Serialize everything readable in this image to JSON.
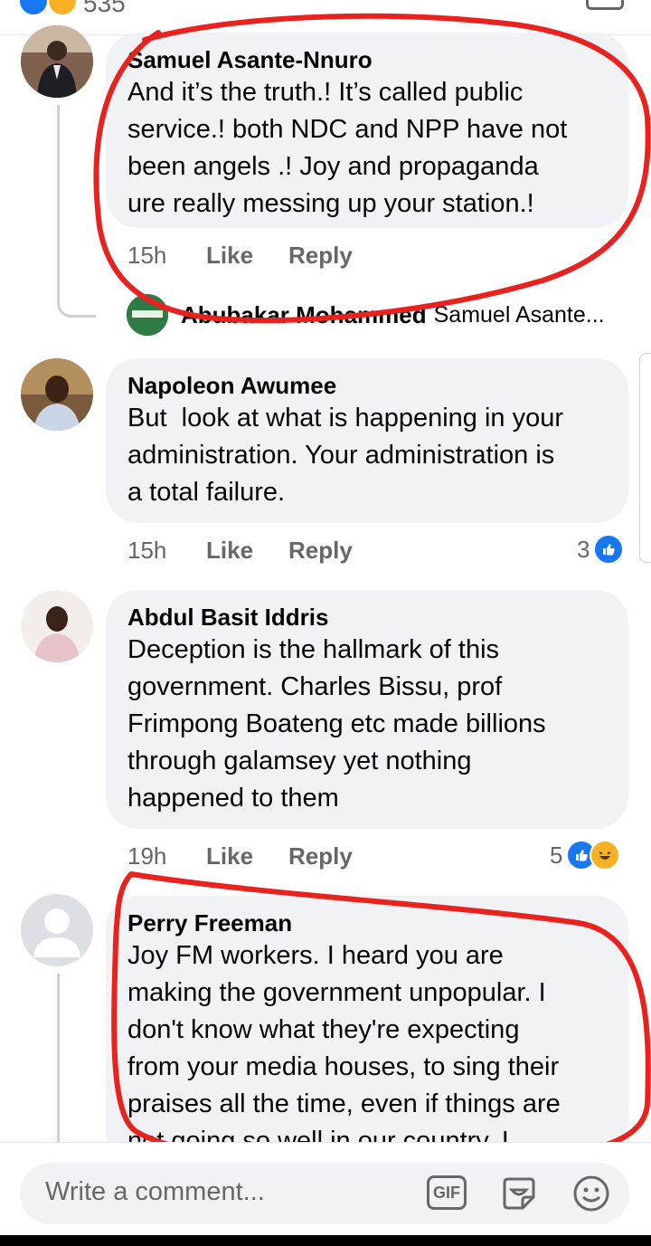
{
  "header": {
    "reaction_count": "535"
  },
  "comments": [
    {
      "author": "Samuel Asante-Nnuro",
      "text": "And it’s the truth.! It’s called public\nservice.! both NDC and NPP have not\nbeen angels .! Joy and propaganda\nure really messing up your station.!",
      "time": "15h",
      "like": "Like",
      "reply": "Reply"
    },
    {
      "author": "Napoleon Awumee",
      "text": "But  look at what is happening in your\nadministration. Your administration is\na total failure.",
      "time": "15h",
      "like": "Like",
      "reply": "Reply",
      "reaction_count": "3"
    },
    {
      "author": "Abdul Basit Iddris",
      "text": "Deception is the hallmark of this\ngovernment. Charles Bissu, prof\nFrimpong Boateng etc made billions\nthrough galamsey yet nothing\nhappened to them",
      "time": "19h",
      "like": "Like",
      "reply": "Reply",
      "reaction_count": "5"
    },
    {
      "author": "Perry Freeman",
      "text": "Joy FM workers. I heard you are\nmaking the government unpopular. I\ndon't know what they're expecting\nfrom your media houses, to sing their\npraises all the time, even if things are\nnot going so well in our country. I",
      "time": "",
      "like": "",
      "reply": ""
    }
  ],
  "reply_preview": {
    "author": "Abubakar Mohammed",
    "text": "Samuel Asante..."
  },
  "composer": {
    "placeholder": "Write a comment...",
    "gif_label": "GIF"
  },
  "colors": {
    "accent": "#1877f2",
    "annotation": "#e8231f",
    "bubble": "#f0f2f5"
  }
}
